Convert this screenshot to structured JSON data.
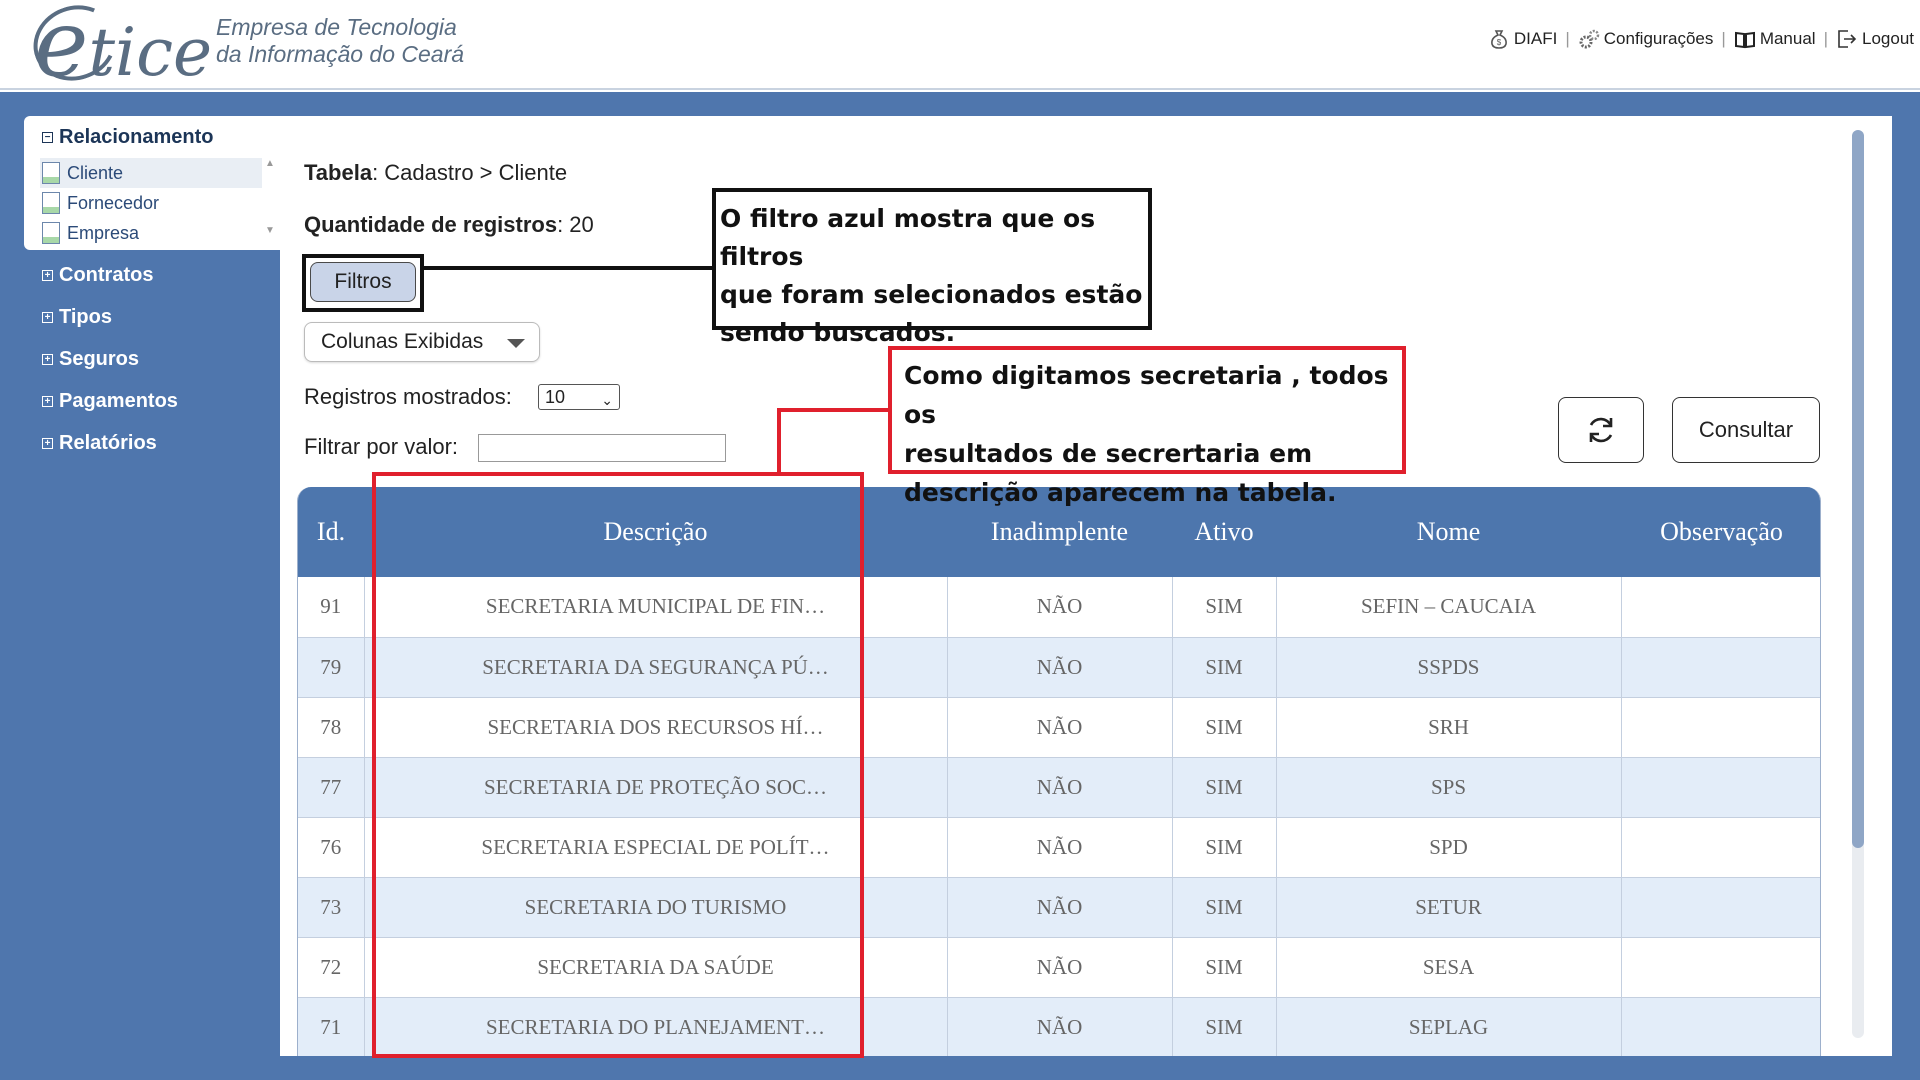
{
  "header": {
    "logo_e": "e",
    "logo_word": "tice",
    "company_line1": "Empresa de Tecnologia",
    "company_line2": "da Informação do Ceará",
    "nav": [
      {
        "label": "DIAFI",
        "icon": "money-bag-icon"
      },
      {
        "label": "Configurações",
        "icon": "gears-icon"
      },
      {
        "label": "Manual",
        "icon": "book-icon"
      },
      {
        "label": "Logout",
        "icon": "logout-icon"
      }
    ]
  },
  "sidebar": {
    "open_group": {
      "title": "Relacionamento",
      "items": [
        "Cliente",
        "Fornecedor",
        "Empresa"
      ]
    },
    "groups": [
      "Contratos",
      "Tipos",
      "Seguros",
      "Pagamentos",
      "Relatórios"
    ]
  },
  "main": {
    "breadcrumb_label": "Tabela",
    "breadcrumb_value": ": Cadastro > Cliente",
    "qty_label": "Quantidade de registros",
    "qty_value": ": 20",
    "filtros_button": "Filtros",
    "colunas_button": "Colunas Exibidas",
    "registros_label": "Registros mostrados:",
    "registros_value": "10",
    "filtrar_label": "Filtrar por valor:",
    "filtrar_value": "",
    "consultar_button": "Consultar"
  },
  "table": {
    "columns": [
      "Id.",
      "Descrição",
      "Inadimplente",
      "Ativo",
      "Nome",
      "Observação"
    ],
    "rows": [
      [
        "91",
        "SECRETARIA MUNICIPAL DE FIN…",
        "NÃO",
        "SIM",
        "SEFIN – CAUCAIA",
        ""
      ],
      [
        "79",
        "SECRETARIA DA SEGURANÇA PÚ…",
        "NÃO",
        "SIM",
        "SSPDS",
        ""
      ],
      [
        "78",
        "SECRETARIA DOS RECURSOS HÍ…",
        "NÃO",
        "SIM",
        "SRH",
        ""
      ],
      [
        "77",
        "SECRETARIA DE PROTEÇÃO SOC…",
        "NÃO",
        "SIM",
        "SPS",
        ""
      ],
      [
        "76",
        "SECRETARIA ESPECIAL DE POLÍT…",
        "NÃO",
        "SIM",
        "SPD",
        ""
      ],
      [
        "73",
        "SECRETARIA DO TURISMO",
        "NÃO",
        "SIM",
        "SETUR",
        ""
      ],
      [
        "72",
        "SECRETARIA DA SAÚDE",
        "NÃO",
        "SIM",
        "SESA",
        ""
      ],
      [
        "71",
        "SECRETARIA DO PLANEJAMENT…",
        "NÃO",
        "SIM",
        "SEPLAG",
        ""
      ]
    ]
  },
  "annotations": {
    "filter_note": [
      "O filtro azul mostra que os filtros",
      "que foram selecionados estão",
      "sendo buscados."
    ],
    "search_note": [
      "Como digitamos secretaria , todos os",
      "resultados de secrertaria em",
      "descrição aparecem na tabela."
    ]
  },
  "colors": {
    "frame_blue": "#4f76ad",
    "table_header": "#4d76ad",
    "row_alt": "#e3edf9",
    "filter_active": "#c9d4e8",
    "annotation_red": "#e0202d",
    "annotation_black": "#111111"
  }
}
